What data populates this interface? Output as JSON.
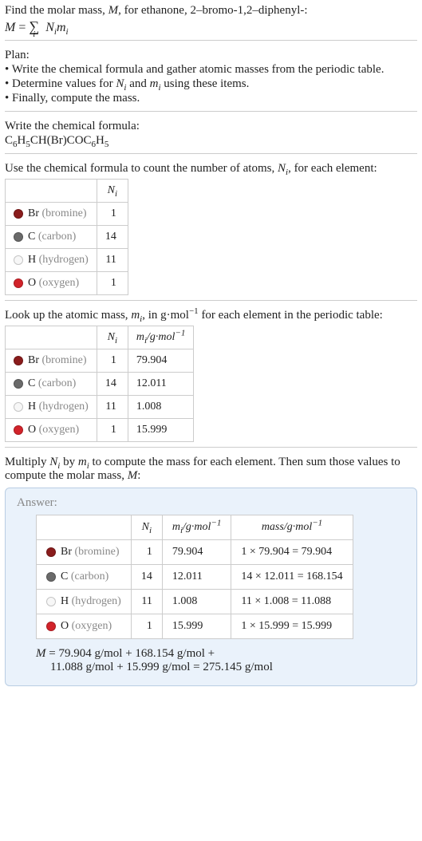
{
  "intro": {
    "line1": "Find the molar mass, M, for ethanone, 2-bromo-1,2-diphenyl-:",
    "formula_prefix": "M = ",
    "formula_sum_under": "i",
    "formula_after": " N_i m_i"
  },
  "plan": {
    "heading": "Plan:",
    "b1": "• Write the chemical formula and gather atomic masses from the periodic table.",
    "b2": "• Determine values for N_i and m_i using these items.",
    "b3": "• Finally, compute the mass."
  },
  "chem": {
    "line1": "Write the chemical formula:",
    "formula": "C6H5CH(Br)COC6H5"
  },
  "count": {
    "line1": "Use the chemical formula to count the number of atoms, N_i, for each element:",
    "col_n": "N_i",
    "rows": [
      {
        "sym": "Br",
        "name": "bromine",
        "dot": "br-dot",
        "n": "1"
      },
      {
        "sym": "C",
        "name": "carbon",
        "dot": "c-dot",
        "n": "14"
      },
      {
        "sym": "H",
        "name": "hydrogen",
        "dot": "h-dot",
        "n": "11"
      },
      {
        "sym": "O",
        "name": "oxygen",
        "dot": "o-dot",
        "n": "1"
      }
    ]
  },
  "mass": {
    "line1": "Look up the atomic mass, m_i, in g·mol⁻¹ for each element in the periodic table:",
    "col_n": "N_i",
    "col_m": "m_i /g·mol⁻¹",
    "rows": [
      {
        "sym": "Br",
        "name": "bromine",
        "dot": "br-dot",
        "n": "1",
        "m": "79.904"
      },
      {
        "sym": "C",
        "name": "carbon",
        "dot": "c-dot",
        "n": "14",
        "m": "12.011"
      },
      {
        "sym": "H",
        "name": "hydrogen",
        "dot": "h-dot",
        "n": "11",
        "m": "1.008"
      },
      {
        "sym": "O",
        "name": "oxygen",
        "dot": "o-dot",
        "n": "1",
        "m": "15.999"
      }
    ]
  },
  "mult": {
    "line1": "Multiply N_i by m_i to compute the mass for each element. Then sum those values to compute the molar mass, M:"
  },
  "answer": {
    "label": "Answer:",
    "col_n": "N_i",
    "col_m": "m_i /g·mol⁻¹",
    "col_mass": "mass/g·mol⁻¹",
    "rows": [
      {
        "sym": "Br",
        "name": "bromine",
        "dot": "br-dot",
        "n": "1",
        "m": "79.904",
        "calc": "1 × 79.904 = 79.904"
      },
      {
        "sym": "C",
        "name": "carbon",
        "dot": "c-dot",
        "n": "14",
        "m": "12.011",
        "calc": "14 × 12.011 = 168.154"
      },
      {
        "sym": "H",
        "name": "hydrogen",
        "dot": "h-dot",
        "n": "11",
        "m": "1.008",
        "calc": "11 × 1.008 = 11.088"
      },
      {
        "sym": "O",
        "name": "oxygen",
        "dot": "o-dot",
        "n": "1",
        "m": "15.999",
        "calc": "1 × 15.999 = 15.999"
      }
    ],
    "sum1": "M = 79.904 g/mol + 168.154 g/mol +",
    "sum2": "11.088 g/mol + 15.999 g/mol = 275.145 g/mol"
  }
}
